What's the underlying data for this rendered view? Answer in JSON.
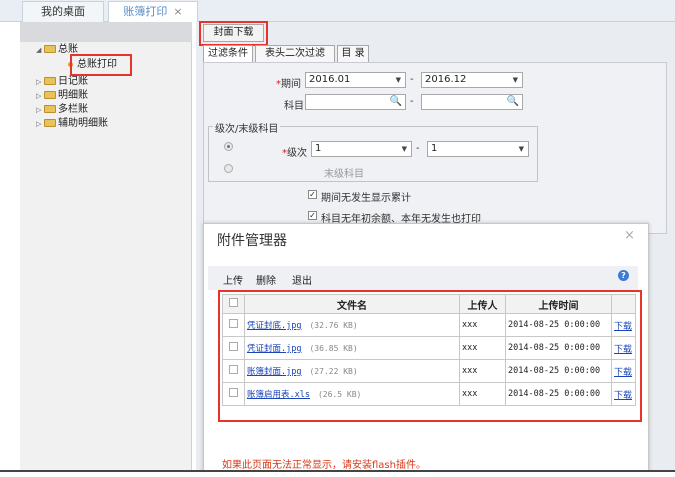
{
  "tabs": {
    "home": "我的桌面",
    "active": "账簿打印",
    "close": "×"
  },
  "tree": {
    "items": [
      {
        "label": "总账"
      },
      {
        "label": "总账打印"
      },
      {
        "label": "日记账"
      },
      {
        "label": "明细账"
      },
      {
        "label": "多栏账"
      },
      {
        "label": "辅助明细账"
      }
    ]
  },
  "toolbar": {
    "cover_download": "封面下载"
  },
  "subtabs": [
    "过滤条件",
    "表头二次过滤",
    "目 录"
  ],
  "filter": {
    "period_label": "期间",
    "period_from": "2016.01",
    "period_to": "2016.12",
    "subject_label": "科目",
    "subject_from": "",
    "subject_to": "",
    "level_group_label": "级次/末级科目",
    "level_label": "级次",
    "level_from": "1",
    "level_to": "1",
    "last_level_label": "末级科目",
    "dash": "-",
    "req_mark": "*",
    "check1": "期间无发生显示累计",
    "check2": "科目无年初余额、本年无发生也打印"
  },
  "modal": {
    "title": "附件管理器",
    "close": "×",
    "tools": {
      "upload": "上传",
      "delete": "删除",
      "exit": "退出"
    },
    "help": "?",
    "columns": {
      "filename": "文件名",
      "uploader": "上传人",
      "upload_time": "上传时间"
    },
    "rows": [
      {
        "name": "凭证封底.jpg",
        "size": "(32.76 KB)",
        "uploader": "xxx",
        "time": "2014-08-25 0:00:00",
        "action": "下载"
      },
      {
        "name": "凭证封面.jpg",
        "size": "(36.85 KB)",
        "uploader": "xxx",
        "time": "2014-08-25 0:00:00",
        "action": "下载"
      },
      {
        "name": "账簿封面.jpg",
        "size": "(27.22 KB)",
        "uploader": "xxx",
        "time": "2014-08-25 0:00:00",
        "action": "下载"
      },
      {
        "name": "账簿启用表.xls",
        "size": "(26.5 KB)",
        "uploader": "xxx",
        "time": "2014-08-25 0:00:00",
        "action": "下载"
      }
    ],
    "warning": "如果此页面无法正常显示，请安装flash插件。"
  },
  "colors": {
    "highlight": "#e8332b",
    "link": "#1a44b8",
    "warning": "#d83a1a"
  }
}
